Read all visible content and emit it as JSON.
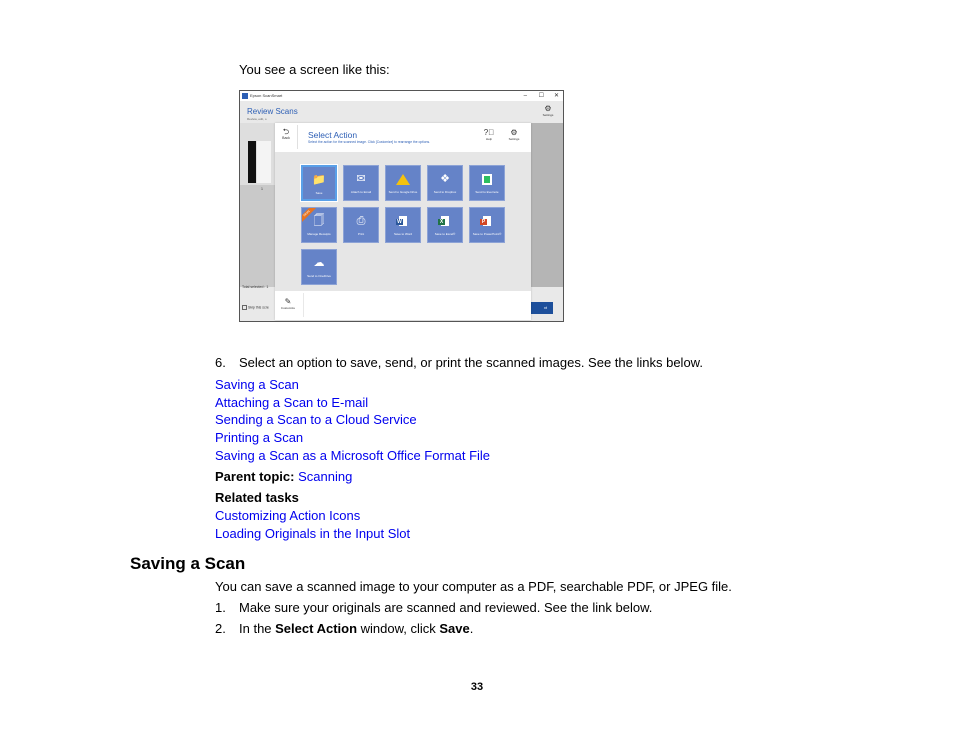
{
  "intro": "You see a screen like this:",
  "screenshot": {
    "window_title": "Epson ScanSmart",
    "window_buttons": [
      "–",
      "☐",
      "✕"
    ],
    "background": {
      "title": "Review Scans",
      "subtitle": "Review, edit, o",
      "thumbnail_number": "1",
      "total_selected": "Total selected : 1",
      "skip_label": "Skip this scre",
      "settings_label": "Settings",
      "next_label": "xt"
    },
    "dialog": {
      "back_label": "Back",
      "title": "Select Action",
      "subtitle": "Select the action for the scanned image. Click [Customize] to rearrange the options.",
      "help_label": "Help",
      "settings_label": "Settings",
      "customize_label": "Customize",
      "tiles": [
        {
          "label": "Save",
          "icon": "folder-save-icon",
          "selected": true
        },
        {
          "label": "Attach to Email",
          "icon": "envelope-icon"
        },
        {
          "label": "Send to Google Drive",
          "icon": "google-drive-icon"
        },
        {
          "label": "Send to Dropbox",
          "icon": "dropbox-icon"
        },
        {
          "label": "Send to Evernote",
          "icon": "evernote-icon"
        },
        {
          "label": "Manage Receipts",
          "icon": "receipt-icon",
          "badge": "TRIAL"
        },
        {
          "label": "Print",
          "icon": "printer-icon"
        },
        {
          "label": "Save to Word",
          "icon": "word-icon",
          "letter": "W",
          "color": "#2b579a"
        },
        {
          "label": "Save to Excel®",
          "icon": "excel-icon",
          "letter": "X",
          "color": "#217346"
        },
        {
          "label": "Save to PowerPoint®",
          "icon": "powerpoint-icon",
          "letter": "P",
          "color": "#d24726"
        },
        {
          "label": "Send to OneDrive",
          "icon": "onedrive-icon"
        }
      ]
    }
  },
  "step6": {
    "number": "6.",
    "text": "Select an option to save, send, or print the scanned images. See the links below."
  },
  "links": [
    "Saving a Scan",
    "Attaching a Scan to E-mail",
    "Sending a Scan to a Cloud Service",
    "Printing a Scan",
    "Saving a Scan as a Microsoft Office Format File"
  ],
  "parent_topic": {
    "label": "Parent topic:",
    "link": "Scanning"
  },
  "related": {
    "heading": "Related tasks",
    "links": [
      "Customizing Action Icons",
      "Loading Originals in the Input Slot"
    ]
  },
  "section": {
    "heading": "Saving a Scan",
    "intro": "You can save a scanned image to your computer as a PDF, searchable PDF, or JPEG file.",
    "step1": {
      "number": "1.",
      "text": "Make sure your originals are scanned and reviewed. See the link below."
    },
    "step2": {
      "number": "2.",
      "pre": "In the ",
      "bold1": "Select Action",
      "mid": " window, click ",
      "bold2": "Save",
      "post": "."
    }
  },
  "page_number": "33",
  "colors": {
    "link": "#0000ee",
    "tile": "#6583c8",
    "accent": "#2d5fb5"
  }
}
